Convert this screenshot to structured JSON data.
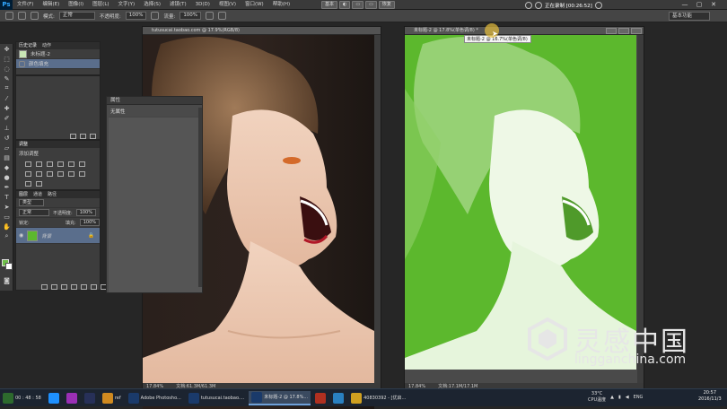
{
  "menubar": {
    "logo": "Ps",
    "items": [
      "文件(F)",
      "编辑(E)",
      "图像(I)",
      "图层(L)",
      "文字(Y)",
      "选择(S)",
      "滤镜(T)",
      "3D(D)",
      "视图(V)",
      "窗口(W)",
      "帮助(H)"
    ],
    "center_buttons": [
      "基本",
      "◐",
      "▭",
      "▭",
      "恢复"
    ],
    "recording_text": "正在录制 [00:26:52]",
    "window_buttons": [
      "—",
      "▢",
      "✕"
    ]
  },
  "options": {
    "mode_label": "模式:",
    "mode_value": "正常",
    "opacity_label": "不透明度:",
    "opacity_value": "100%",
    "flow_label": "流量:",
    "flow_value": "100%",
    "workspace": "基本功能"
  },
  "history_panel": {
    "tabs": [
      "历史记录",
      "动作"
    ],
    "snapshot_label": "未标题-2",
    "rows": [
      "颜色填充"
    ]
  },
  "adjustments_panel": {
    "tabs": [
      "调整"
    ],
    "title": "添加调整"
  },
  "layers_panel": {
    "tabs": [
      "图层",
      "通道",
      "路径"
    ],
    "filter_label": "类型",
    "blend_mode": "正常",
    "opacity_label": "不透明度:",
    "opacity_value": "100%",
    "lock_label": "锁定:",
    "fill_label": "填充:",
    "fill_value": "100%",
    "layer_name": "背景"
  },
  "properties_panel": {
    "title": "属性",
    "body": "无属性"
  },
  "doc_left": {
    "title": "tutusucai.taobao.com @ 17.9%(RGB/8)",
    "zoom": "17.84%",
    "doc_size": "文档:61.3M/61.3M"
  },
  "doc_right": {
    "title": "未标题-2 @ 17.8%(单色调/8) *",
    "zoom": "17.84%",
    "doc_size": "文档:17.1M/17.1M",
    "tooltip": "未标题-2 @ 16.7%(单色调/8)"
  },
  "watermark": {
    "cn": "灵感中国",
    "en": "lingganchina.com"
  },
  "taskbar": {
    "apps": [
      {
        "label": "00 : 48 : 58",
        "color": "#2d6a2d",
        "active": false
      },
      {
        "label": "",
        "color": "#1e90ff",
        "active": false
      },
      {
        "label": "",
        "color": "#9a2fb5",
        "active": false
      },
      {
        "label": "",
        "color": "#273058",
        "active": false
      },
      {
        "label": "ref",
        "color": "#d08a20",
        "active": false
      },
      {
        "label": "Adobe Photosho...",
        "color": "#1a3a6a",
        "active": false
      },
      {
        "label": "tutusucai.taobao....",
        "color": "#1a3a6a",
        "active": false
      },
      {
        "label": "未标题-2 @ 17.8%...",
        "color": "#1a3a6a",
        "active": true
      },
      {
        "label": "",
        "color": "#b03020",
        "active": false
      },
      {
        "label": "",
        "color": "#2a80c0",
        "active": false
      },
      {
        "label": "40830392 - [优启...",
        "color": "#d0a020",
        "active": false
      }
    ],
    "tray": {
      "temp": "33°C",
      "temp_label": "CPU温度",
      "lang": "ENG"
    },
    "time": "20:57",
    "date": "2016/11/3"
  },
  "colors": {
    "accent_green": "#5cb82d",
    "panel_bg": "#3d3d3d",
    "workspace_bg": "#262626"
  }
}
